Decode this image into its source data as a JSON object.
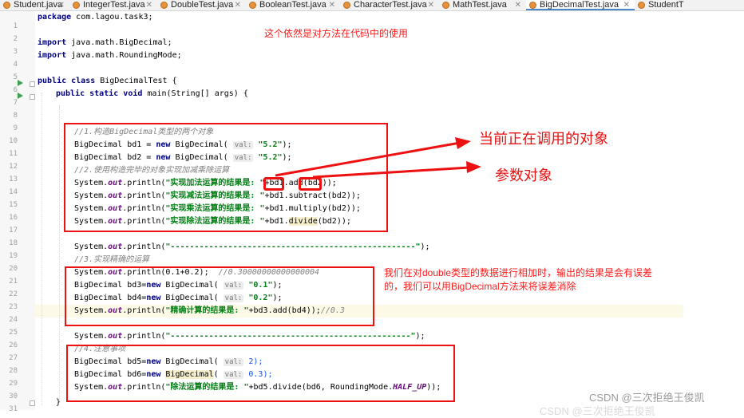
{
  "tabs": [
    {
      "label": "Student.java"
    },
    {
      "label": "IntegerTest.java"
    },
    {
      "label": "DoubleTest.java"
    },
    {
      "label": "BooleanTest.java"
    },
    {
      "label": "CharacterTest.java"
    },
    {
      "label": "MathTest.java"
    },
    {
      "label": "BigDecimalTest.java",
      "active": true
    },
    {
      "label": "StudentT"
    }
  ],
  "line_numbers": [
    "1",
    "2",
    "3",
    "4",
    "5",
    "6",
    "7",
    "8",
    "9",
    "10",
    "11",
    "12",
    "13",
    "14",
    "15",
    "16",
    "17",
    "18",
    "19",
    "20",
    "21",
    "22",
    "23",
    "24",
    "25",
    "26",
    "27",
    "28",
    "29",
    "30",
    "31"
  ],
  "code": {
    "l1": {
      "kw": "package",
      "rest": " com.lagou.task3;"
    },
    "l3": {
      "kw": "import",
      "rest": " java.math.BigDecimal;"
    },
    "l4": {
      "kw": "import",
      "rest": " java.math.RoundingMode;"
    },
    "l6": {
      "kw1": "public",
      "kw2": " class",
      "rest": " BigDecimalTest {"
    },
    "l7": {
      "kw1": "public",
      "kw2": " static",
      "kw3": " void",
      "rest": " main(String[] args) {"
    },
    "l11": {
      "comment": "//1.构造BigDecimal类型的两个对象"
    },
    "l12": {
      "a": "BigDecimal bd1 = ",
      "kw": "new",
      "b": " BigDecimal( ",
      "hint": "val:",
      "str": " \"5.2\"",
      "c": ");"
    },
    "l13": {
      "a": "BigDecimal bd2 = ",
      "kw": "new",
      "b": " BigDecimal( ",
      "hint": "val:",
      "str": " \"5.2\"",
      "c": ");"
    },
    "l14": {
      "comment": "//2.使用构造完毕的对象实现加减乘除运算"
    },
    "l15": {
      "a": "System.",
      "out": "out",
      "b": ".println(",
      "str": "\"实现加法运算的结果是: \"",
      "c": "+",
      "d": "bd1",
      "e": ".add(",
      "f": "bd2",
      "g": "));"
    },
    "l16": {
      "a": "System.",
      "out": "out",
      "b": ".println(",
      "str": "\"实现减法运算的结果是: \"",
      "c": "+bd1.subtract(bd2));"
    },
    "l17": {
      "a": "System.",
      "out": "out",
      "b": ".println(",
      "str": "\"实现乘法运算的结果是: \"",
      "c": "+bd1.multiply(bd2));"
    },
    "l18": {
      "a": "System.",
      "out": "out",
      "b": ".println(",
      "str": "\"实现除法运算的结果是: \"",
      "c": "+bd1.",
      "d": "divide",
      "e": "(bd2));"
    },
    "l20": {
      "a": "System.",
      "out": "out",
      "b": ".println(",
      "str": "\"---------------------------------------------------\"",
      "c": ");"
    },
    "l21": {
      "comment": "//3.实现精确的运算"
    },
    "l22": {
      "a": "System.",
      "out": "out",
      "b": ".println(0.1+0.2);  ",
      "comment": "//0.30000000000000004"
    },
    "l23": {
      "a": "BigDecimal bd3=",
      "kw": "new",
      "b": " BigDecimal( ",
      "hint": "val:",
      "str": " \"0.1\"",
      "c": ");"
    },
    "l24": {
      "a": "BigDecimal bd4=",
      "kw": "new",
      "b": " BigDecimal( ",
      "hint": "val:",
      "str": " \"0.2\"",
      "c": ");"
    },
    "l25": {
      "a": "System.",
      "out": "out",
      "b": ".println(",
      "str": "\"精确计算的结果是: \"",
      "c": "+bd3.add(bd4));",
      "comment": "//0.3"
    },
    "l27": {
      "a": "System.",
      "out": "out",
      "b": ".println(",
      "str": "\"--------------------------------------------------\"",
      "c": ");"
    },
    "l28": {
      "comment": "//4.注意事项"
    },
    "l29": {
      "a": "BigDecimal bd5=",
      "kw": "new",
      "b": " BigDecimal( ",
      "hint": "val:",
      "c": " 2);"
    },
    "l30": {
      "a": "BigDecimal bd6=",
      "kw": "new",
      "b": " ",
      "cls": "BigDecimal",
      "b2": "( ",
      "hint": "val:",
      "c": " 0.3);"
    },
    "l31": {
      "a": "System.",
      "out": "out",
      "b": ".println(",
      "str": "\"除法运算的结果是: \"",
      "c": "+bd5.divide(bd6, RoundingMode.",
      "fd": "HALF_UP",
      "d": "));"
    },
    "l32": {
      "rest": "}"
    }
  },
  "annotations": {
    "top_note": "这个依然是对方法在代码中的使用",
    "current_object": "当前正在调用的对象",
    "param_object": "参数对象",
    "double_note_line1": "我们在对double类型的数据进行相加时，输出的结果是会有误差",
    "double_note_line2": "的，我们可以用BigDecimal方法来将误差消除"
  },
  "watermark": {
    "text": "CSDN @三次拒绝王俊凯",
    "ghost": "CSDN @三次拒绝王俊凯"
  },
  "colors": {
    "annotation_red": "#ee1111",
    "keyword": "#000080",
    "string": "#067d17",
    "comment": "#808080",
    "static_field": "#660e7a"
  }
}
